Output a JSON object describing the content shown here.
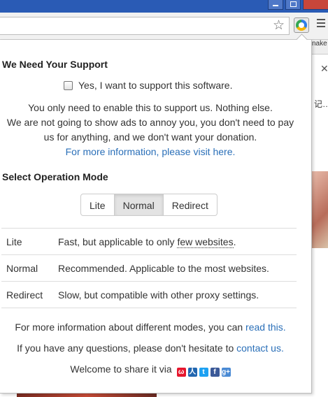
{
  "browser": {
    "bg_tab_text": "nake",
    "bg_cjk_text": "记…"
  },
  "popup": {
    "support_heading": "We Need Your Support",
    "support_checkbox_label": "Yes, I want to support this software.",
    "support_checkbox_checked": false,
    "support_lines": [
      "You only need to enable this to support us. Nothing else.",
      "We are not going to show ads to annoy you, you don't need to pay",
      "us for anything, and we don't want your donation."
    ],
    "more_info_link": "For more information, please visit here.",
    "mode_heading": "Select Operation Mode",
    "mode_buttons": [
      "Lite",
      "Normal",
      "Redirect"
    ],
    "selected_mode": "Normal",
    "modes": [
      {
        "name": "Lite",
        "desc_prefix": "Fast, but applicable to only ",
        "desc_link": "few websites",
        "desc_suffix": "."
      },
      {
        "name": "Normal",
        "desc": "Recommended. Applicable to the most websites."
      },
      {
        "name": "Redirect",
        "desc": "Slow, but compatible with other proxy settings."
      }
    ],
    "footer": {
      "modes_info_prefix": "For more information about different modes, you can ",
      "modes_info_link": "read this.",
      "questions_prefix": "If you have any questions, please don't hesitate to ",
      "questions_link": "contact us.",
      "share_text": "Welcome to share it via"
    },
    "share_icons": [
      "weibo-icon",
      "renren-icon",
      "twitter-icon",
      "facebook-icon",
      "google-plus-icon"
    ]
  },
  "colors": {
    "link": "#2a6fb8",
    "titlebar": "#2a5bb5"
  }
}
